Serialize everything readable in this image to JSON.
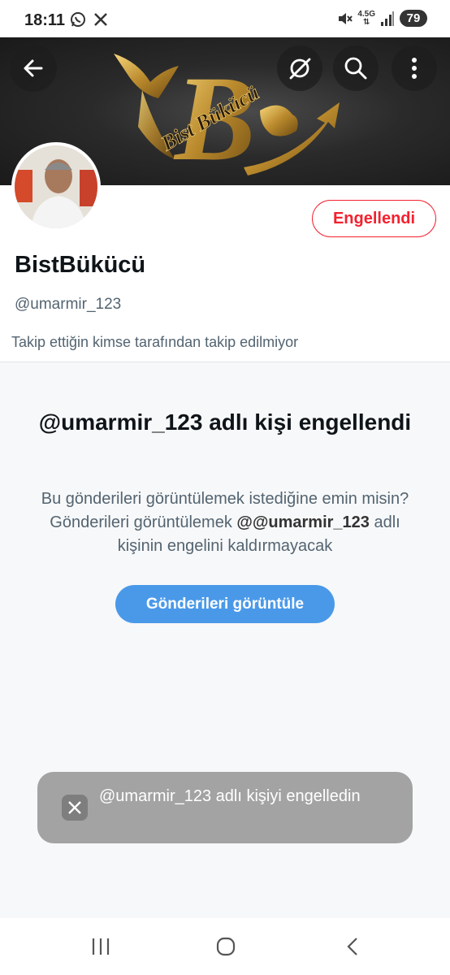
{
  "status_bar": {
    "time": "18:11",
    "network": "4.5G",
    "battery": "79",
    "icons": [
      "whatsapp-icon",
      "x-icon",
      "mute-icon",
      "signal-icon"
    ]
  },
  "banner": {
    "brand_text": "Bist Bükücü",
    "logo_letter": "B"
  },
  "profile": {
    "display_name": "BistBükücü",
    "handle": "@umarmir_123",
    "follow_note": "Takip ettiğin kimse tarafından takip edilmiyor",
    "blocked_label": "Engellendi"
  },
  "blocked_panel": {
    "title": "@umarmir_123 adlı kişi engellendi",
    "desc_part1": "Bu gönderileri görüntülemek istediğine emin misin? Gönderileri görüntülemek ",
    "desc_handle": "@@umarmir_123",
    "desc_part2": " adlı kişinin engelini kaldırmayacak",
    "view_button": "Gönderileri görüntüle"
  },
  "toast": {
    "text": "@umarmir_123 adlı kişiyi engelledin"
  },
  "colors": {
    "danger": "#f4212e",
    "primary": "#4a99e9",
    "muted_text": "#536471"
  }
}
